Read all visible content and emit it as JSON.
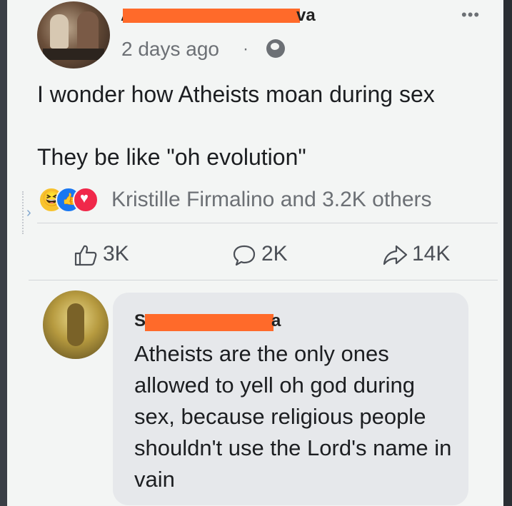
{
  "post": {
    "author_visible_start": "A",
    "author_visible_end": "va",
    "timestamp": "2 days ago",
    "separator": "·",
    "privacy_icon": "globe-icon",
    "more_icon": "more-options-icon",
    "text_line1": "I wonder how Atheists moan during sex",
    "text_line2": "They be like \"oh evolution\"",
    "reactions": [
      "haha",
      "like",
      "love"
    ],
    "reaction_summary": "Kristille Firmalino and 3.2K others",
    "actions": {
      "like_count": "3K",
      "comment_count": "2K",
      "share_count": "14K"
    }
  },
  "comment": {
    "author_visible_start": "S",
    "author_visible_end": "a",
    "text": "Atheists are the only ones allowed to yell oh god during sex, because religious people shouldn't use the Lord's name in vain"
  },
  "colors": {
    "redaction": "#ff6a2a",
    "like_blue": "#1877f2",
    "love_red": "#f0284a",
    "haha_yellow": "#f7c32e"
  }
}
